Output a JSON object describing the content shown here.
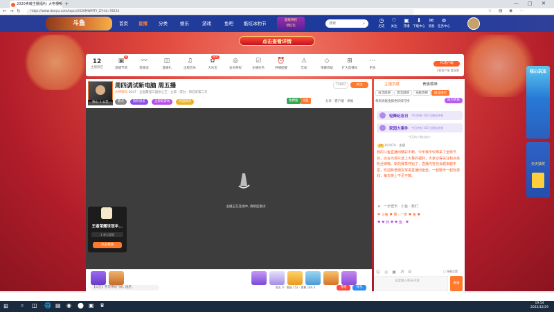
{
  "browser": {
    "tab_title": "2020卖萌主播福利: 大电视哦",
    "url": "https://www.douyu.com/topic/2020MWMTY_Z?rid=78234",
    "new_tab": "+",
    "min": "—",
    "max": "▢",
    "close": "✕"
  },
  "site": {
    "logo_text": "斗鱼",
    "nav": [
      "首页",
      "直播",
      "分类",
      "娱乐",
      "游戏",
      "鱼吧",
      "酷炫冰豹节"
    ],
    "promo_line1": "超级特权",
    "promo_line2": "领红包",
    "search_placeholder": "搜索",
    "top_icons": [
      "历史",
      "关注",
      "开播",
      "下载中心",
      "消息",
      "任务中心"
    ]
  },
  "banner": {
    "cta": "点击查看详情"
  },
  "category_bar": {
    "room_count": "12",
    "room_count_label": "主播排名",
    "items": [
      {
        "label": "直播节目",
        "icon": "▣",
        "badge": "9"
      },
      {
        "label": "客服话",
        "icon": "〰",
        "badge": ""
      },
      {
        "label": "直播礼",
        "icon": "◫",
        "badge": ""
      },
      {
        "label": "正版音乐",
        "icon": "♫",
        "badge": ""
      },
      {
        "label": "大乐宝",
        "icon": "✿",
        "badge": "HOT"
      },
      {
        "label": "会员特权",
        "icon": "◎",
        "badge": ""
      },
      {
        "label": "主播任务",
        "icon": "☑",
        "badge": ""
      },
      {
        "label": "开播提醒",
        "icon": "⏰",
        "badge": ""
      },
      {
        "label": "告知",
        "icon": "⚠",
        "badge": ""
      },
      {
        "label": "荣耀等级",
        "icon": "◇",
        "badge": ""
      },
      {
        "label": "扩大直播间",
        "icon": "⊞",
        "badge": ""
      },
      {
        "label": "更多",
        "icon": "⋯",
        "badge": ""
      }
    ],
    "pc_client": "PC客户端",
    "pc_client_sub": "下载客户端 看直播"
  },
  "room": {
    "title": "周四调试新电脑 周五播",
    "avatar_caption": "伤心 1 公告",
    "meta_prefix": "大神科科",
    "meta_rest": "2647 · 全国最强三国杀之王 · 立即 · 成为 · 周冠军第二天",
    "tags": [
      "看点",
      "狗狗道说",
      "全部新游戏",
      "跨国精英"
    ],
    "room_id": "72807",
    "follow": "关注",
    "rank_badges": [
      "免费版",
      "斗鱼"
    ],
    "actions": "分享 · 客户端 · 举报"
  },
  "video": {
    "loading_text": "主播正在连线中, 请稍后重试"
  },
  "game_card": {
    "title": "王者荣耀世冠半...",
    "subtitle": "1 参与竞猜",
    "button": "点击预测"
  },
  "gift_bar": {
    "danmu_tip": "【公告】在可用喷飞机, 送后",
    "balance": "鱼丸 0 · 鱼翅 152 · 鱼粮 184.3",
    "charge": "充值",
    "bag": "背包"
  },
  "chat": {
    "tabs": [
      "主播贡献",
      "贵族榜单"
    ],
    "subtabs": [
      "日活跃榜",
      "周活跃榜",
      "贡献周榜",
      "粉丝排行"
    ],
    "notice": "每周贡献金额更新排行榜",
    "cta": "成为贵族",
    "events": [
      {
        "title": "轻舞纪念日",
        "sub": "今日共有 102 位粉丝庆祝"
      },
      {
        "title": "家园大事件",
        "sub": "今日共有 102 位粉丝庆祝"
      }
    ],
    "filler": "今天的人数比较少",
    "user_level": "24",
    "user_name": "ROOTA · 主播",
    "message": "我的斗鱼直播间精彩不断。今年我不仅带来了全新节目，还会为观众送上大量的福利，大家记得关注和点亮粉丝牌哦。新的赛季开始了，直播内容也会越来越丰富，欢迎新老朋友常来直播间坐坐，一起聊天一起玩游戏，每天晚上不见不散。",
    "icon_row1": "★ · 一步登天 · 小鱼 · 我们",
    "icon_row2": "❤ 斗鱼 ♥ 我 · 一步 ♥ 鱼 ♥",
    "icon_row3": "♥ ♥ 我 ♥ ♥ 鱼 · ♥",
    "tools": "☺ ◎ ▣ ♬ ⚙",
    "toggle": "□ 弹幕设置",
    "input_placeholder": "这里输入聊天内容",
    "send": "发送"
  },
  "side_ads": {
    "ad1_title": "核心玩法",
    "ad2_title": "天天抽奖"
  },
  "taskbar": {
    "start": "⊞",
    "apps": [
      "⌕",
      "◫",
      "🌐",
      "▤",
      "◉",
      "⬤",
      "▣",
      "♛"
    ],
    "time": "19:54",
    "date": "2022/12/29"
  },
  "colors": {
    "accent": "#ff7a2d",
    "nav_bg": "#1f3b9a",
    "banner": "#e24a3e"
  }
}
